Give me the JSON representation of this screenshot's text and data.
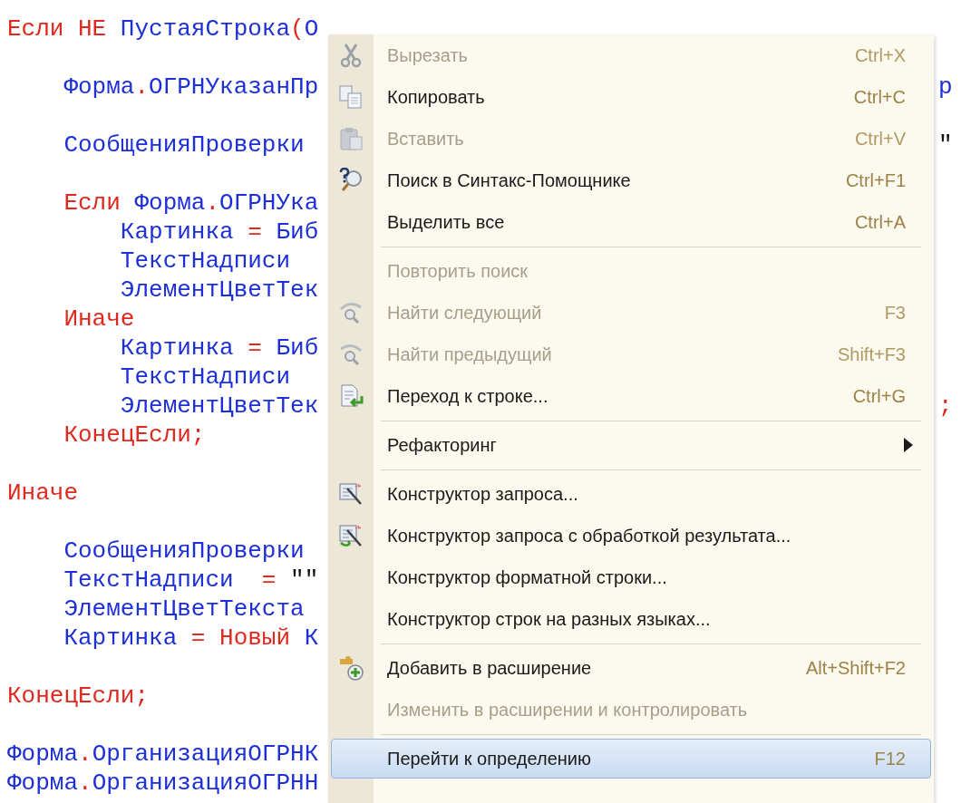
{
  "code_lines": [
    {
      "kind": "code",
      "tokens": [
        {
          "kind": "keyword",
          "text": "Если НЕ "
        },
        {
          "kind": "ident",
          "text": "ПустаяСтрока"
        },
        {
          "kind": "op",
          "text": "("
        },
        {
          "kind": "ident",
          "text": "О"
        }
      ]
    },
    {
      "kind": "blank"
    },
    {
      "kind": "code",
      "tokens": [
        {
          "kind": "ident",
          "text": "    Форма"
        },
        {
          "kind": "op",
          "text": "."
        },
        {
          "kind": "ident",
          "text": "ОГРНУказанПр"
        }
      ],
      "tail": {
        "kind": "ident",
        "text": "р"
      }
    },
    {
      "kind": "blank"
    },
    {
      "kind": "code",
      "tokens": [
        {
          "kind": "ident",
          "text": "    СообщенияПроверки"
        }
      ],
      "tail": {
        "kind": "string",
        "text": "\""
      }
    },
    {
      "kind": "blank"
    },
    {
      "kind": "code",
      "tokens": [
        {
          "kind": "keyword",
          "text": "    Если "
        },
        {
          "kind": "ident",
          "text": "Форма"
        },
        {
          "kind": "op",
          "text": "."
        },
        {
          "kind": "ident",
          "text": "ОГРНУка"
        }
      ]
    },
    {
      "kind": "code",
      "tokens": [
        {
          "kind": "ident",
          "text": "        Картинка"
        },
        {
          "kind": "op",
          "text": " = "
        },
        {
          "kind": "ident",
          "text": "Биб"
        }
      ]
    },
    {
      "kind": "code",
      "tokens": [
        {
          "kind": "ident",
          "text": "        ТекстНадписи"
        }
      ]
    },
    {
      "kind": "code",
      "tokens": [
        {
          "kind": "ident",
          "text": "        ЭлементЦветТек"
        }
      ]
    },
    {
      "kind": "code",
      "tokens": [
        {
          "kind": "keyword",
          "text": "    Иначе"
        }
      ]
    },
    {
      "kind": "code",
      "tokens": [
        {
          "kind": "ident",
          "text": "        Картинка"
        },
        {
          "kind": "op",
          "text": " = "
        },
        {
          "kind": "ident",
          "text": "Биб"
        }
      ]
    },
    {
      "kind": "code",
      "tokens": [
        {
          "kind": "ident",
          "text": "        ТекстНадписи"
        }
      ]
    },
    {
      "kind": "code",
      "tokens": [
        {
          "kind": "ident",
          "text": "        ЭлементЦветТек"
        }
      ],
      "tail": {
        "kind": "op",
        "text": ";"
      }
    },
    {
      "kind": "code",
      "tokens": [
        {
          "kind": "keyword",
          "text": "    КонецЕсли;"
        }
      ]
    },
    {
      "kind": "blank"
    },
    {
      "kind": "code",
      "tokens": [
        {
          "kind": "keyword",
          "text": "Иначе"
        }
      ]
    },
    {
      "kind": "blank"
    },
    {
      "kind": "code",
      "tokens": [
        {
          "kind": "ident",
          "text": "    СообщенияПроверки"
        }
      ]
    },
    {
      "kind": "code",
      "tokens": [
        {
          "kind": "ident",
          "text": "    ТекстНадписи"
        },
        {
          "kind": "op",
          "text": "  = "
        },
        {
          "kind": "string",
          "text": "\"\""
        }
      ]
    },
    {
      "kind": "code",
      "tokens": [
        {
          "kind": "ident",
          "text": "    ЭлементЦветТекста"
        }
      ]
    },
    {
      "kind": "code",
      "tokens": [
        {
          "kind": "ident",
          "text": "    Картинка"
        },
        {
          "kind": "op",
          "text": " = "
        },
        {
          "kind": "keyword",
          "text": "Новый "
        },
        {
          "kind": "ident",
          "text": "К"
        }
      ]
    },
    {
      "kind": "blank"
    },
    {
      "kind": "code",
      "tokens": [
        {
          "kind": "keyword",
          "text": "КонецЕсли;"
        }
      ]
    },
    {
      "kind": "blank"
    },
    {
      "kind": "code",
      "tokens": [
        {
          "kind": "ident",
          "text": "Форма"
        },
        {
          "kind": "op",
          "text": "."
        },
        {
          "kind": "ident",
          "text": "ОрганизацияОГРНК"
        }
      ]
    },
    {
      "kind": "code",
      "tokens": [
        {
          "kind": "ident",
          "text": "Форма"
        },
        {
          "kind": "op",
          "text": "."
        },
        {
          "kind": "ident",
          "text": "ОрганизацияОГРНН"
        }
      ]
    }
  ],
  "context_menu": {
    "items": [
      {
        "kind": "item",
        "label": "Вырезать",
        "shortcut": "Ctrl+X",
        "disabled": true,
        "selected": false
      },
      {
        "kind": "item",
        "label": "Копировать",
        "shortcut": "Ctrl+C",
        "disabled": false,
        "selected": false
      },
      {
        "kind": "item",
        "label": "Вставить",
        "shortcut": "Ctrl+V",
        "disabled": true,
        "selected": false
      },
      {
        "kind": "item",
        "label": "Поиск в Синтакс-Помощнике",
        "shortcut": "Ctrl+F1",
        "disabled": false,
        "selected": false
      },
      {
        "kind": "item",
        "label": "Выделить все",
        "shortcut": "Ctrl+A",
        "disabled": false,
        "selected": false
      },
      {
        "kind": "separator"
      },
      {
        "kind": "item",
        "label": "Повторить поиск",
        "disabled": true,
        "selected": false
      },
      {
        "kind": "item",
        "label": "Найти следующий",
        "shortcut": "F3",
        "disabled": true,
        "selected": false
      },
      {
        "kind": "item",
        "label": "Найти предыдущий",
        "shortcut": "Shift+F3",
        "disabled": true,
        "selected": false
      },
      {
        "kind": "item",
        "label": "Переход к строке...",
        "shortcut": "Ctrl+G",
        "disabled": false,
        "selected": false
      },
      {
        "kind": "separator"
      },
      {
        "kind": "submenu",
        "label": "Рефакторинг",
        "disabled": false,
        "selected": false
      },
      {
        "kind": "separator"
      },
      {
        "kind": "item",
        "label": "Конструктор запроса...",
        "disabled": false,
        "selected": false
      },
      {
        "kind": "item",
        "label": "Конструктор запроса с обработкой результата...",
        "disabled": false,
        "selected": false
      },
      {
        "kind": "item",
        "label": "Конструктор форматной строки...",
        "disabled": false,
        "selected": false
      },
      {
        "kind": "item",
        "label": "Конструктор строк на разных языках...",
        "disabled": false,
        "selected": false
      },
      {
        "kind": "separator"
      },
      {
        "kind": "item",
        "label": "Добавить в расширение",
        "shortcut": "Alt+Shift+F2",
        "disabled": false,
        "selected": false
      },
      {
        "kind": "item",
        "label": "Изменить в расширении и контролировать",
        "disabled": true,
        "selected": false
      },
      {
        "kind": "separator"
      },
      {
        "kind": "item",
        "label": "Перейти к определению",
        "shortcut": "F12",
        "disabled": false,
        "selected": true
      }
    ]
  }
}
